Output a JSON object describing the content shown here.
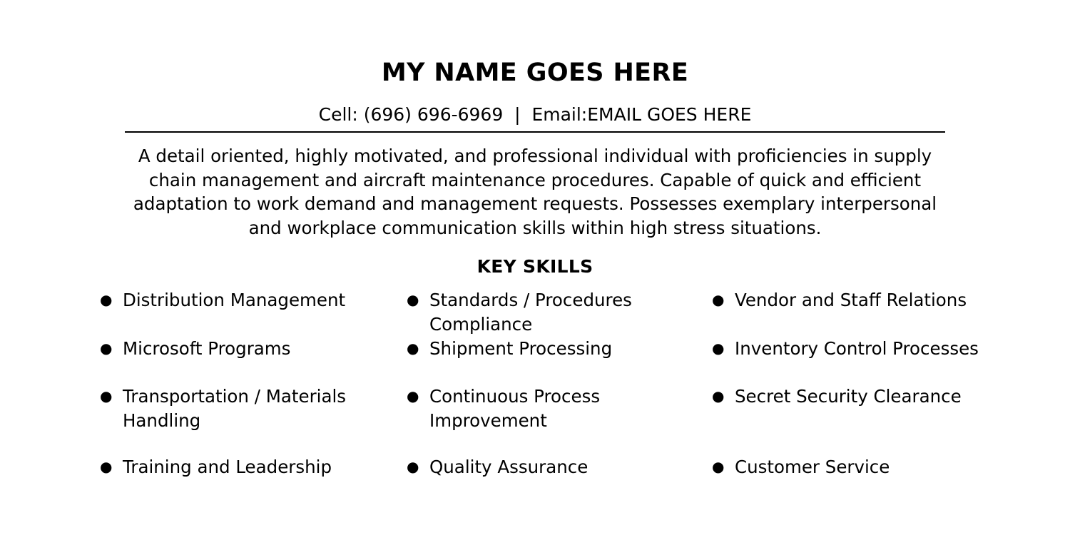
{
  "document": {
    "name_title": "MY NAME GOES HERE",
    "contact": {
      "full_line": "Cell: (696) 696-6969  |  Email:EMAIL GOES HERE",
      "cell_label": "Cell:",
      "cell_number": "(696) 696-6969",
      "separator": "|",
      "email_label": "Email:",
      "email_value": "EMAIL GOES HERE"
    },
    "summary": "A detail oriented, highly motivated, and professional individual with proficiencies in supply chain management and aircraft maintenance procedures. Capable of quick and efficient adaptation to work demand and management requests. Possesses exemplary interpersonal and workplace communication skills within high stress situations.",
    "sections": {
      "key_skills": {
        "heading": "KEY SKILLS",
        "bullet_glyph": "●",
        "columns": [
          {
            "items": [
              "Distribution Management",
              "Microsoft Programs",
              "Transportation / Materials Handling",
              "Training and Leadership"
            ]
          },
          {
            "items": [
              "Standards / Procedures Compliance",
              "Shipment Processing",
              "Continuous Process Improvement",
              "Quality Assurance"
            ]
          },
          {
            "items": [
              "Vendor and Staff Relations",
              "Inventory Control Processes",
              "Secret Security Clearance",
              "Customer Service"
            ]
          }
        ]
      }
    },
    "colors": {
      "page_background": "#ffffff",
      "text": "#000000",
      "rule": "#000000"
    }
  }
}
